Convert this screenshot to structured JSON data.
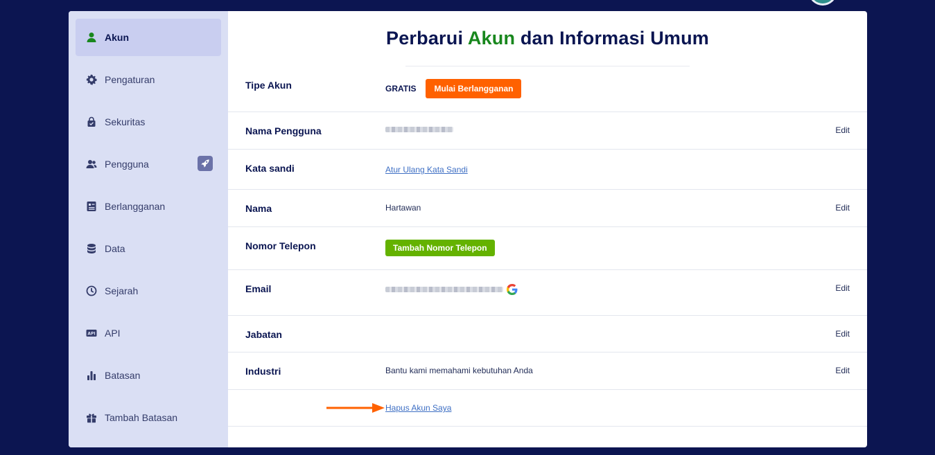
{
  "page": {
    "title_prefix": "Perbarui ",
    "title_accent": "Akun",
    "title_suffix": " dan Informasi Umum"
  },
  "sidebar": {
    "items": [
      {
        "label": "Akun",
        "icon": "user-icon",
        "active": true
      },
      {
        "label": "Pengaturan",
        "icon": "gear-icon"
      },
      {
        "label": "Sekuritas",
        "icon": "lock-bag-icon"
      },
      {
        "label": "Pengguna",
        "icon": "users-icon",
        "badge_icon": "rocket-icon"
      },
      {
        "label": "Berlangganan",
        "icon": "billing-icon"
      },
      {
        "label": "Data",
        "icon": "database-icon"
      },
      {
        "label": "Sejarah",
        "icon": "history-icon"
      },
      {
        "label": "API",
        "icon": "api-icon"
      },
      {
        "label": "Batasan",
        "icon": "bar-chart-icon"
      },
      {
        "label": "Tambah Batasan",
        "icon": "gift-icon"
      }
    ]
  },
  "rows": {
    "account_type": {
      "label": "Tipe Akun",
      "plan": "GRATIS",
      "button": "Mulai Berlangganan"
    },
    "username": {
      "label": "Nama Pengguna",
      "edit": "Edit"
    },
    "password": {
      "label": "Kata sandi",
      "link": "Atur Ulang Kata Sandi"
    },
    "name": {
      "label": "Nama",
      "value": "Hartawan",
      "edit": "Edit"
    },
    "phone": {
      "label": "Nomor Telepon",
      "button": "Tambah Nomor Telepon"
    },
    "email": {
      "label": "Email",
      "edit": "Edit",
      "provider_icon": "google-icon"
    },
    "position": {
      "label": "Jabatan",
      "edit": "Edit"
    },
    "industry": {
      "label": "Industri",
      "value": "Bantu kami memahami kebutuhan Anda",
      "edit": "Edit"
    },
    "delete": {
      "link": "Hapus Akun Saya"
    }
  },
  "colors": {
    "background": "#0c1551",
    "accent_green": "#18871d",
    "orange": "#ff6100",
    "green_button": "#64b200",
    "link": "#3e6fc4",
    "sidebar": "#dadff4"
  }
}
